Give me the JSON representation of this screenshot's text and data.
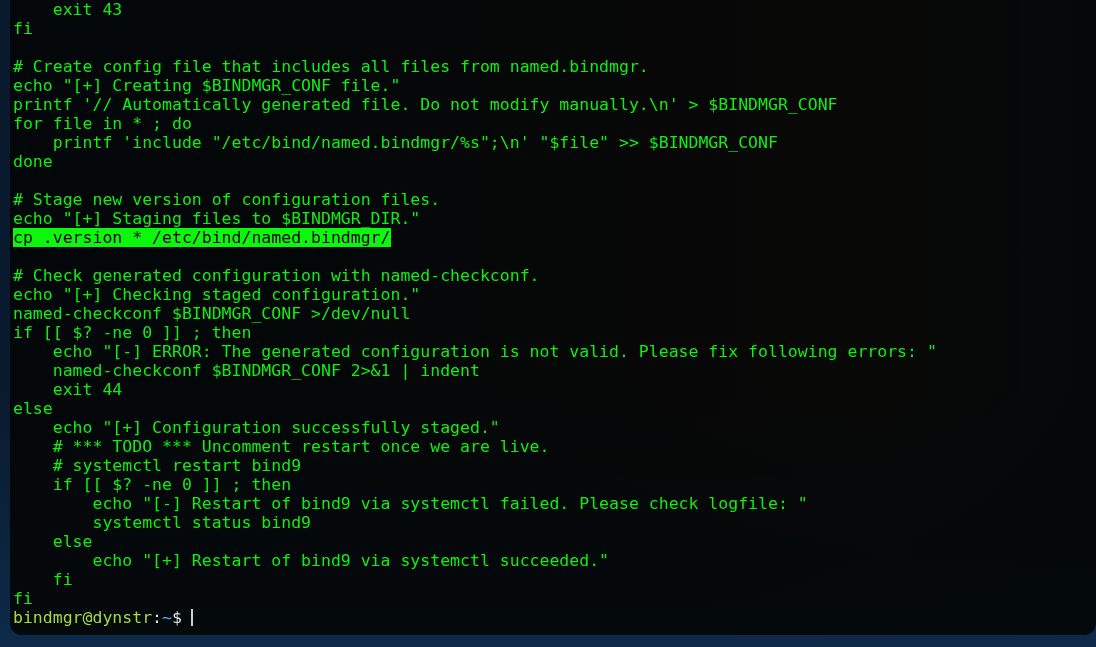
{
  "terminal": {
    "lines": [
      {
        "kind": "text",
        "text": "    exit 43",
        "selected": false
      },
      {
        "kind": "text",
        "text": "fi",
        "selected": false
      },
      {
        "kind": "blank"
      },
      {
        "kind": "text",
        "text": "# Create config file that includes all files from named.bindmgr.",
        "selected": false
      },
      {
        "kind": "text",
        "text": "echo \"[+] Creating $BINDMGR_CONF file.\"",
        "selected": false
      },
      {
        "kind": "text",
        "text": "printf '// Automatically generated file. Do not modify manually.\\n' > $BINDMGR_CONF",
        "selected": false
      },
      {
        "kind": "text",
        "text": "for file in * ; do",
        "selected": false
      },
      {
        "kind": "text",
        "text": "    printf 'include \"/etc/bind/named.bindmgr/%s\";\\n' \"$file\" >> $BINDMGR_CONF",
        "selected": false
      },
      {
        "kind": "text",
        "text": "done",
        "selected": false
      },
      {
        "kind": "blank"
      },
      {
        "kind": "text",
        "text": "# Stage new version of configuration files.",
        "selected": false
      },
      {
        "kind": "text",
        "text": "echo \"[+] Staging files to $BINDMGR_DIR.\"",
        "selected": false
      },
      {
        "kind": "text",
        "text": "cp .version * /etc/bind/named.bindmgr/",
        "selected": true
      },
      {
        "kind": "blank"
      },
      {
        "kind": "text",
        "text": "# Check generated configuration with named-checkconf.",
        "selected": false
      },
      {
        "kind": "text",
        "text": "echo \"[+] Checking staged configuration.\"",
        "selected": false
      },
      {
        "kind": "text",
        "text": "named-checkconf $BINDMGR_CONF >/dev/null",
        "selected": false
      },
      {
        "kind": "text",
        "text": "if [[ $? -ne 0 ]] ; then",
        "selected": false
      },
      {
        "kind": "text",
        "text": "    echo \"[-] ERROR: The generated configuration is not valid. Please fix following errors: \"",
        "selected": false
      },
      {
        "kind": "text",
        "text": "    named-checkconf $BINDMGR_CONF 2>&1 | indent",
        "selected": false
      },
      {
        "kind": "text",
        "text": "    exit 44",
        "selected": false
      },
      {
        "kind": "text",
        "text": "else",
        "selected": false
      },
      {
        "kind": "text",
        "text": "    echo \"[+] Configuration successfully staged.\"",
        "selected": false
      },
      {
        "kind": "text",
        "text": "    # *** TODO *** Uncomment restart once we are live.",
        "selected": false
      },
      {
        "kind": "text",
        "text": "    # systemctl restart bind9",
        "selected": false
      },
      {
        "kind": "text",
        "text": "    if [[ $? -ne 0 ]] ; then",
        "selected": false
      },
      {
        "kind": "text",
        "text": "        echo \"[-] Restart of bind9 via systemctl failed. Please check logfile: \"",
        "selected": false
      },
      {
        "kind": "text",
        "text": "        systemctl status bind9",
        "selected": false
      },
      {
        "kind": "text",
        "text": "    else",
        "selected": false
      },
      {
        "kind": "text",
        "text": "        echo \"[+] Restart of bind9 via systemctl succeeded.\"",
        "selected": false
      },
      {
        "kind": "text",
        "text": "    fi",
        "selected": false
      },
      {
        "kind": "text",
        "text": "fi",
        "selected": false
      }
    ],
    "prompt": {
      "user_host": "bindmgr@dynstr",
      "separator": ":",
      "path": "~",
      "symbol": "$"
    }
  }
}
